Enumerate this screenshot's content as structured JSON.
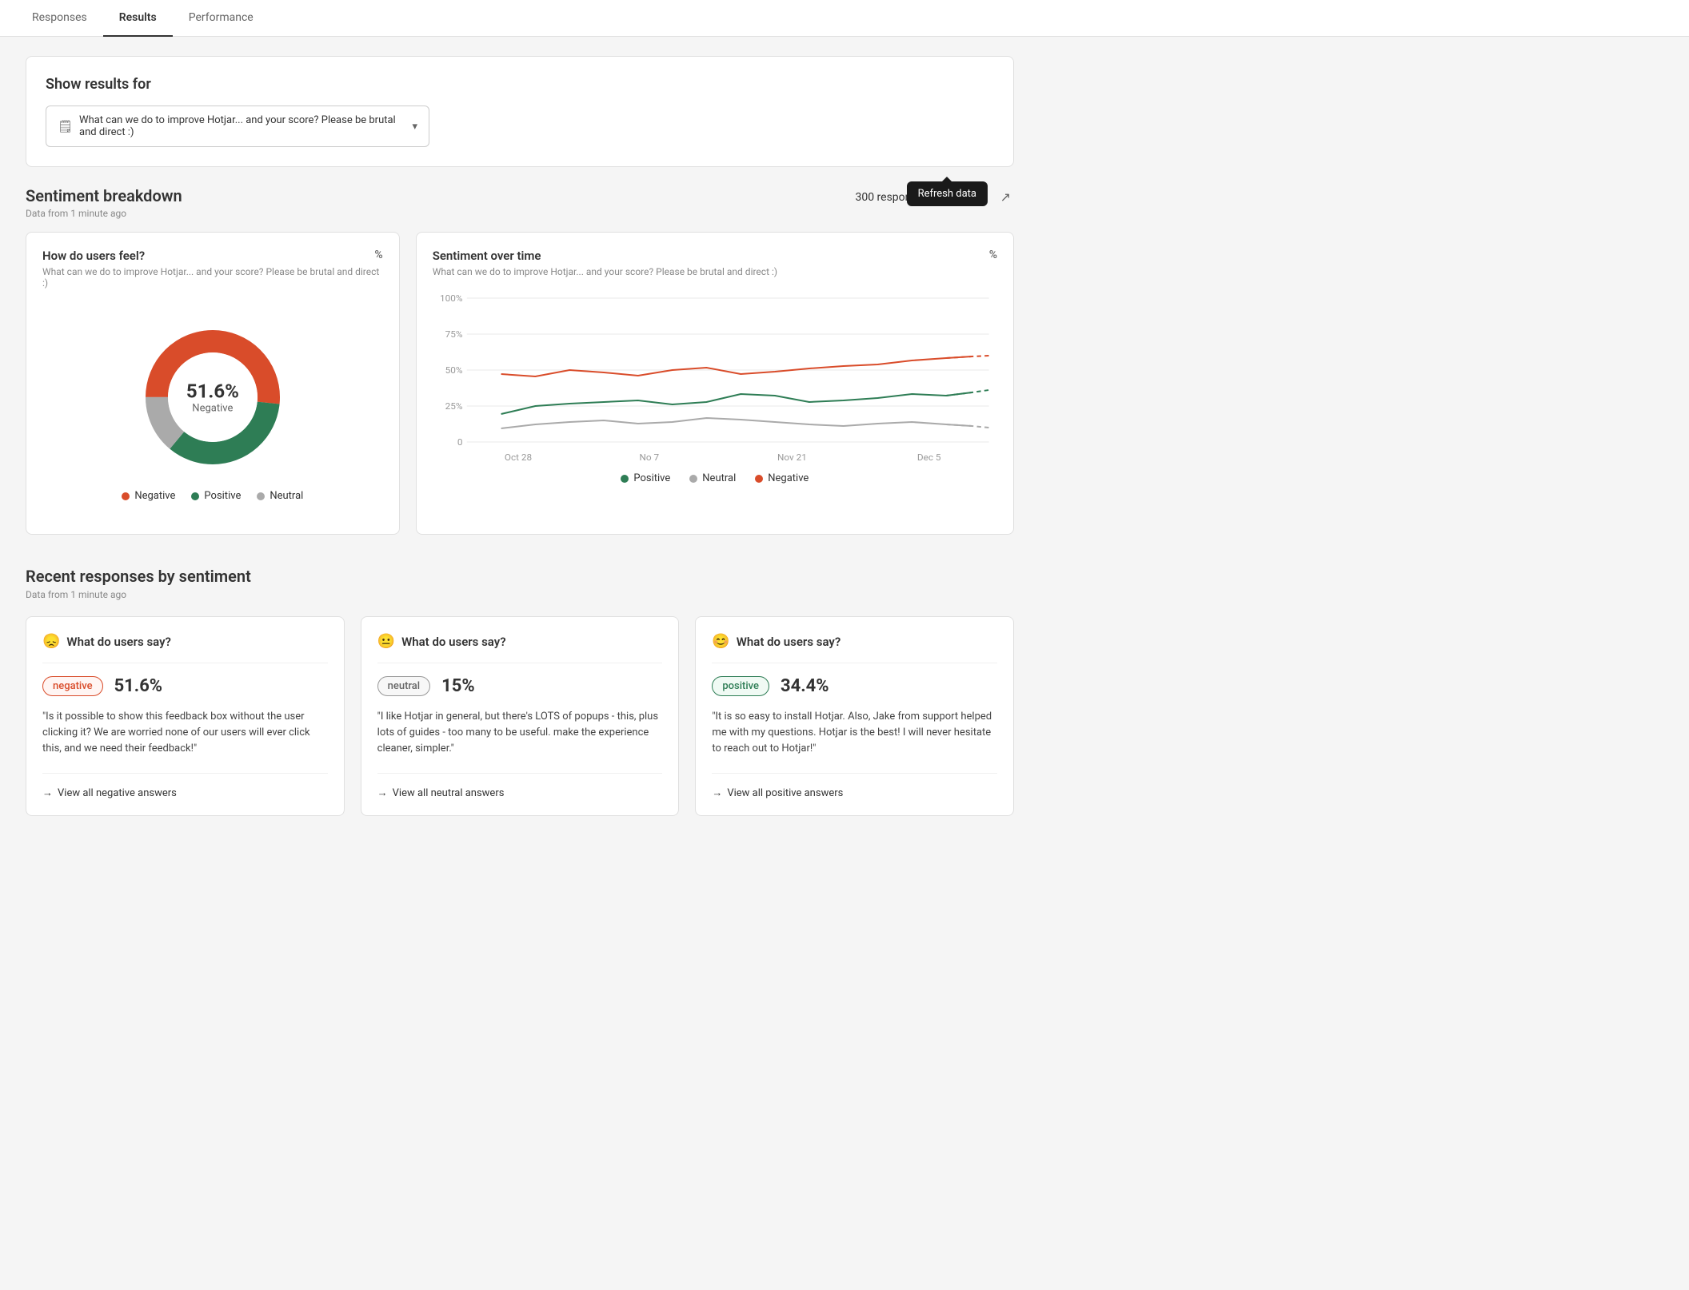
{
  "tabs": [
    {
      "id": "responses",
      "label": "Responses",
      "active": false
    },
    {
      "id": "results",
      "label": "Results",
      "active": true
    },
    {
      "id": "performance",
      "label": "Performance",
      "active": false
    }
  ],
  "show_results": {
    "title": "Show results for",
    "question_icon": "📋",
    "question_text": "What can we do to improve Hotjar... and your score? Please be brutal and direct :)",
    "refresh_label": "Refresh data"
  },
  "sentiment_breakdown": {
    "title": "Sentiment breakdown",
    "subtitle": "Data from 1 minute ago",
    "responses_count": "300 responses",
    "donut_chart": {
      "title": "How do users feel?",
      "subtitle": "What can we do to improve Hotjar... and your score? Please be brutal and direct :)",
      "percent_label": "%",
      "center_pct": "51.6%",
      "center_label": "Negative",
      "segments": [
        {
          "label": "Negative",
          "value": 51.6,
          "color": "#d94c2a"
        },
        {
          "label": "Positive",
          "value": 34.4,
          "color": "#2e7d55"
        },
        {
          "label": "Neutral",
          "value": 14.0,
          "color": "#aaaaaa"
        }
      ]
    },
    "line_chart": {
      "title": "Sentiment over time",
      "subtitle": "What can we do to improve Hotjar... and your score? Please be brutal and direct :)",
      "percent_label": "%",
      "y_labels": [
        "100%",
        "75%",
        "50%",
        "25%",
        "0"
      ],
      "x_labels": [
        "Oct 28",
        "No 7",
        "Nov 21",
        "Dec 5"
      ],
      "legend": [
        {
          "label": "Positive",
          "color": "#2e7d55"
        },
        {
          "label": "Neutral",
          "color": "#aaaaaa"
        },
        {
          "label": "Negative",
          "color": "#d94c2a"
        }
      ]
    }
  },
  "recent_responses": {
    "title": "Recent responses by sentiment",
    "subtitle": "Data from 1 minute ago",
    "cards": [
      {
        "header_icon": "😞",
        "header_text": "What do users say?",
        "badge_label": "negative",
        "badge_type": "negative",
        "percentage": "51.6%",
        "quote": "\"Is it possible to show this feedback box without the user clicking it? We are worried none of our users will ever click this, and we need their feedback!\"",
        "link_text": "View all negative answers"
      },
      {
        "header_icon": "😐",
        "header_text": "What do users say?",
        "badge_label": "neutral",
        "badge_type": "neutral",
        "percentage": "15%",
        "quote": "\"I like Hotjar in general, but there's LOTS of popups - this, plus lots of guides - too many to be useful. make the experience cleaner, simpler.\"",
        "link_text": "View all neutral answers"
      },
      {
        "header_icon": "😊",
        "header_text": "What do users say?",
        "badge_label": "positive",
        "badge_type": "positive",
        "percentage": "34.4%",
        "quote": "\"It is so easy to install Hotjar. Also, Jake from support helped me with my questions. Hotjar is the best! I will never hesitate to reach out to Hotjar!\"",
        "link_text": "View all positive answers"
      }
    ]
  }
}
